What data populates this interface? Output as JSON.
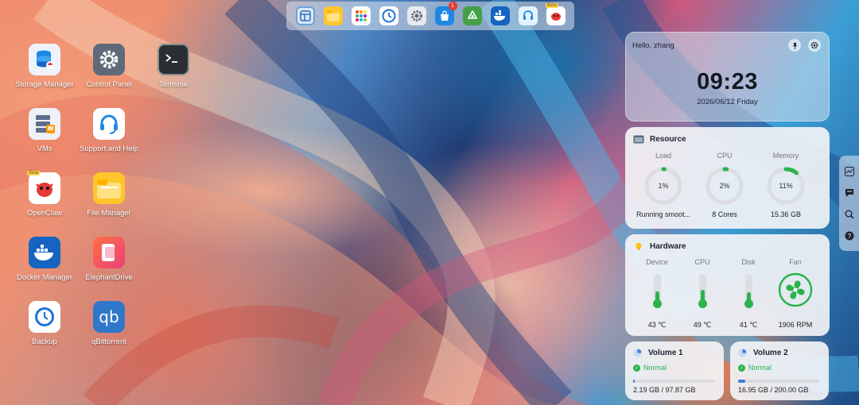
{
  "dock": {
    "items": [
      {
        "icon": "window-manager-icon"
      },
      {
        "icon": "file-manager-icon"
      },
      {
        "icon": "app-center-icon"
      },
      {
        "icon": "backup-icon"
      },
      {
        "icon": "control-panel-icon"
      },
      {
        "icon": "app-store-icon",
        "badge": "1"
      },
      {
        "icon": "recycle-icon"
      },
      {
        "icon": "docker-icon"
      },
      {
        "icon": "support-icon"
      },
      {
        "icon": "openclaw-icon",
        "tag": "Beta"
      }
    ]
  },
  "desktop": {
    "icons": [
      {
        "label": "Storage Manager",
        "icon": "storage-manager-icon"
      },
      {
        "label": "Control Panel",
        "icon": "control-panel-icon"
      },
      {
        "label": "Terminal",
        "icon": "terminal-icon"
      },
      {
        "label": "VMs",
        "icon": "vms-icon"
      },
      {
        "label": "Support and Help",
        "icon": "headset-icon"
      },
      {
        "label": "OpenClaw",
        "icon": "openclaw-icon",
        "tag": "Beta"
      },
      {
        "label": "File Manager",
        "icon": "folder-icon"
      },
      {
        "label": "Docker Manager",
        "icon": "docker-icon"
      },
      {
        "label": "ElephantDrive",
        "icon": "elephantdrive-icon"
      },
      {
        "label": "Backup",
        "icon": "backup-icon"
      },
      {
        "label": "qBittorrent",
        "icon": "qbittorrent-icon",
        "glyph": "qb"
      }
    ]
  },
  "clock": {
    "greeting": "Hello, zhang",
    "time": "09:23",
    "date": "2026/06/12 Friday"
  },
  "resource": {
    "title": "Resource",
    "items": [
      {
        "label": "Load",
        "percent_text": "1%",
        "percent": 1,
        "value": "Running smoot..."
      },
      {
        "label": "CPU",
        "percent_text": "2%",
        "percent": 2,
        "value": "8 Cores"
      },
      {
        "label": "Memory",
        "percent_text": "11%",
        "percent": 11,
        "value": "15.36 GB"
      }
    ]
  },
  "hardware": {
    "title": "Hardware",
    "items": [
      {
        "label": "Device",
        "value": "43 ℃",
        "level": 0.45
      },
      {
        "label": "CPU",
        "value": "49 ℃",
        "level": 0.5
      },
      {
        "label": "Disk",
        "value": "41 ℃",
        "level": 0.42
      },
      {
        "label": "Fan",
        "value": "1906 RPM"
      }
    ]
  },
  "volumes": [
    {
      "name": "Volume 1",
      "status": "Normal",
      "usage": "2.19 GB / 97.87 GB",
      "used_fraction": 0.022
    },
    {
      "name": "Volume 2",
      "status": "Normal",
      "usage": "16.95 GB / 200.00 GB",
      "used_fraction": 0.085
    }
  ],
  "colors": {
    "accent_green": "#2bb24c",
    "accent_blue": "#3d7be3"
  }
}
